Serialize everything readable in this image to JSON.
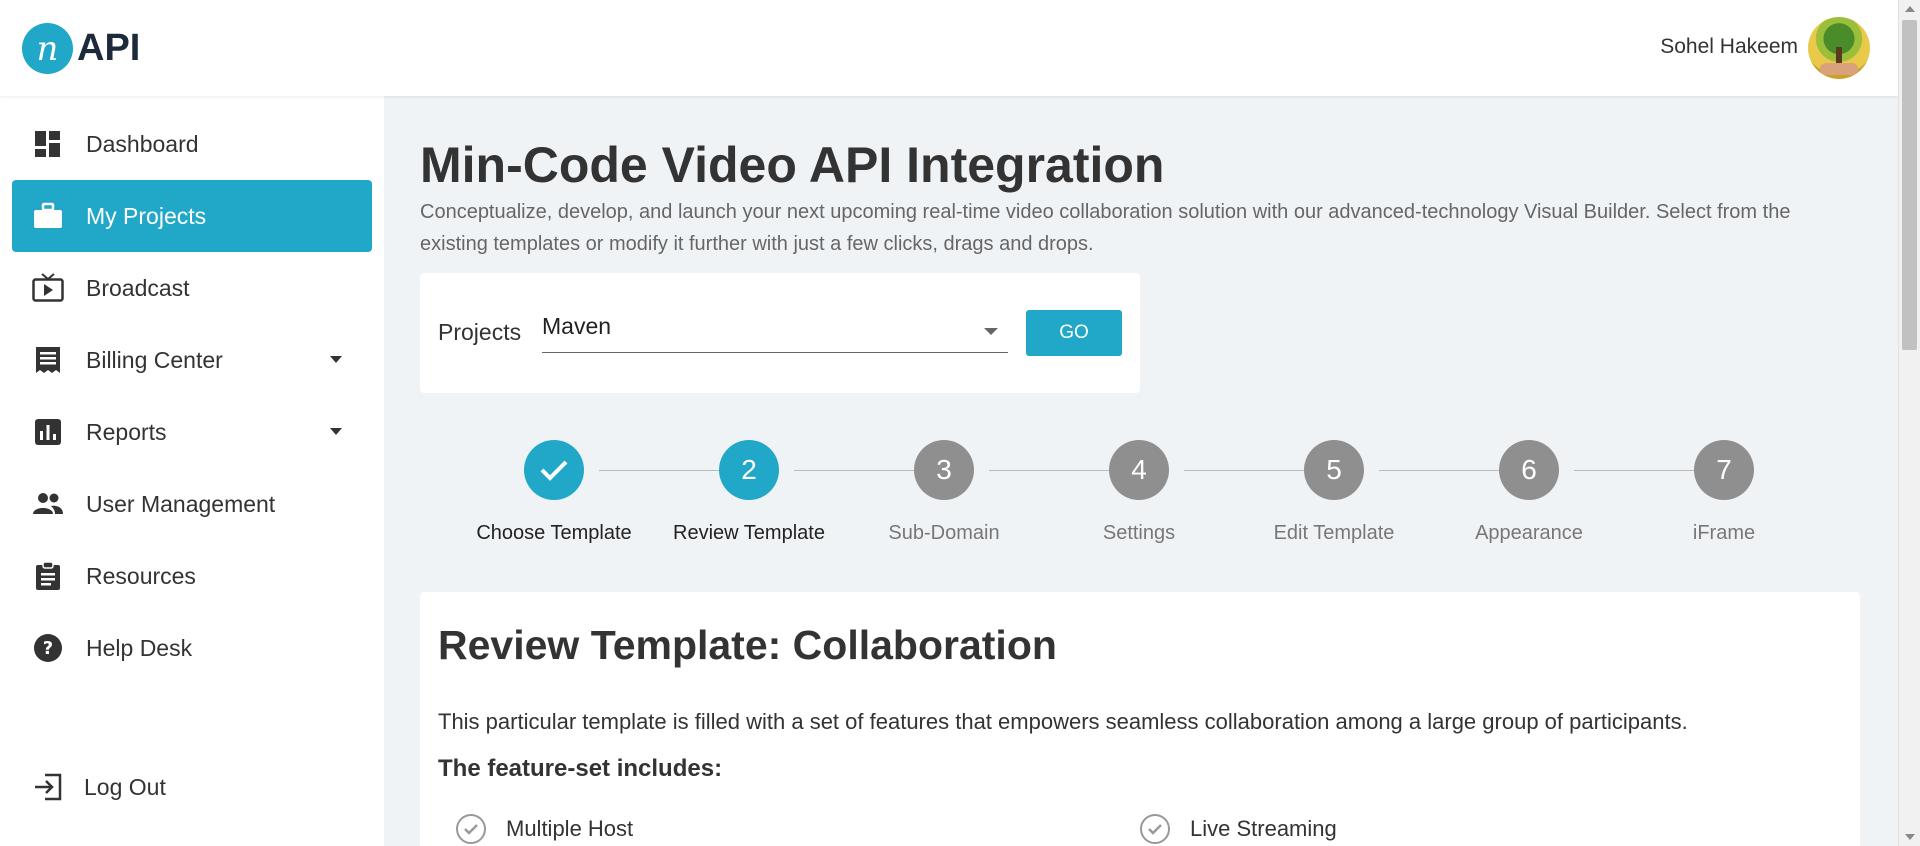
{
  "header": {
    "logo_mark": "n",
    "logo_text": "API",
    "user_name": "Sohel Hakeem",
    "icons": {
      "avatar": "user-avatar-icon"
    }
  },
  "sidebar": {
    "items": [
      {
        "label": "Dashboard",
        "icon": "dashboard-icon"
      },
      {
        "label": "My Projects",
        "icon": "briefcase-icon",
        "active": true
      },
      {
        "label": "Broadcast",
        "icon": "tv-icon"
      },
      {
        "label": "Billing Center",
        "icon": "receipt-icon",
        "has_submenu": true
      },
      {
        "label": "Reports",
        "icon": "bar-chart-icon",
        "has_submenu": true
      },
      {
        "label": "User Management",
        "icon": "people-icon"
      },
      {
        "label": "Resources",
        "icon": "clipboard-icon"
      },
      {
        "label": "Help Desk",
        "icon": "help-icon"
      }
    ],
    "logout_label": "Log Out"
  },
  "main": {
    "title": "Min-Code Video API Integration",
    "description": "Conceptualize, develop, and launch your next upcoming real-time video collaboration solution with our advanced-technology Visual Builder. Select from the existing templates or modify it further with just a few clicks, drags and drops.",
    "projects_label": "Projects",
    "project_selected": "Maven",
    "go_label": "GO"
  },
  "stepper": {
    "steps": [
      {
        "number": "",
        "label": "Choose Template",
        "state": "done"
      },
      {
        "number": "2",
        "label": "Review Template",
        "state": "current"
      },
      {
        "number": "3",
        "label": "Sub-Domain",
        "state": "pending"
      },
      {
        "number": "4",
        "label": "Settings",
        "state": "pending"
      },
      {
        "number": "5",
        "label": "Edit Template",
        "state": "pending"
      },
      {
        "number": "6",
        "label": "Appearance",
        "state": "pending"
      },
      {
        "number": "7",
        "label": "iFrame",
        "state": "pending"
      }
    ]
  },
  "review": {
    "title": "Review Template: Collaboration",
    "description": "This particular template is filled with a set of features that empowers seamless collaboration among a large group of participants.",
    "features_heading": "The feature-set includes:",
    "features": [
      "Multiple Host",
      "Live Streaming"
    ]
  },
  "colors": {
    "accent": "#21a8c9",
    "pending_step": "#8f8f8f",
    "page_bg": "#f0f3f6"
  }
}
